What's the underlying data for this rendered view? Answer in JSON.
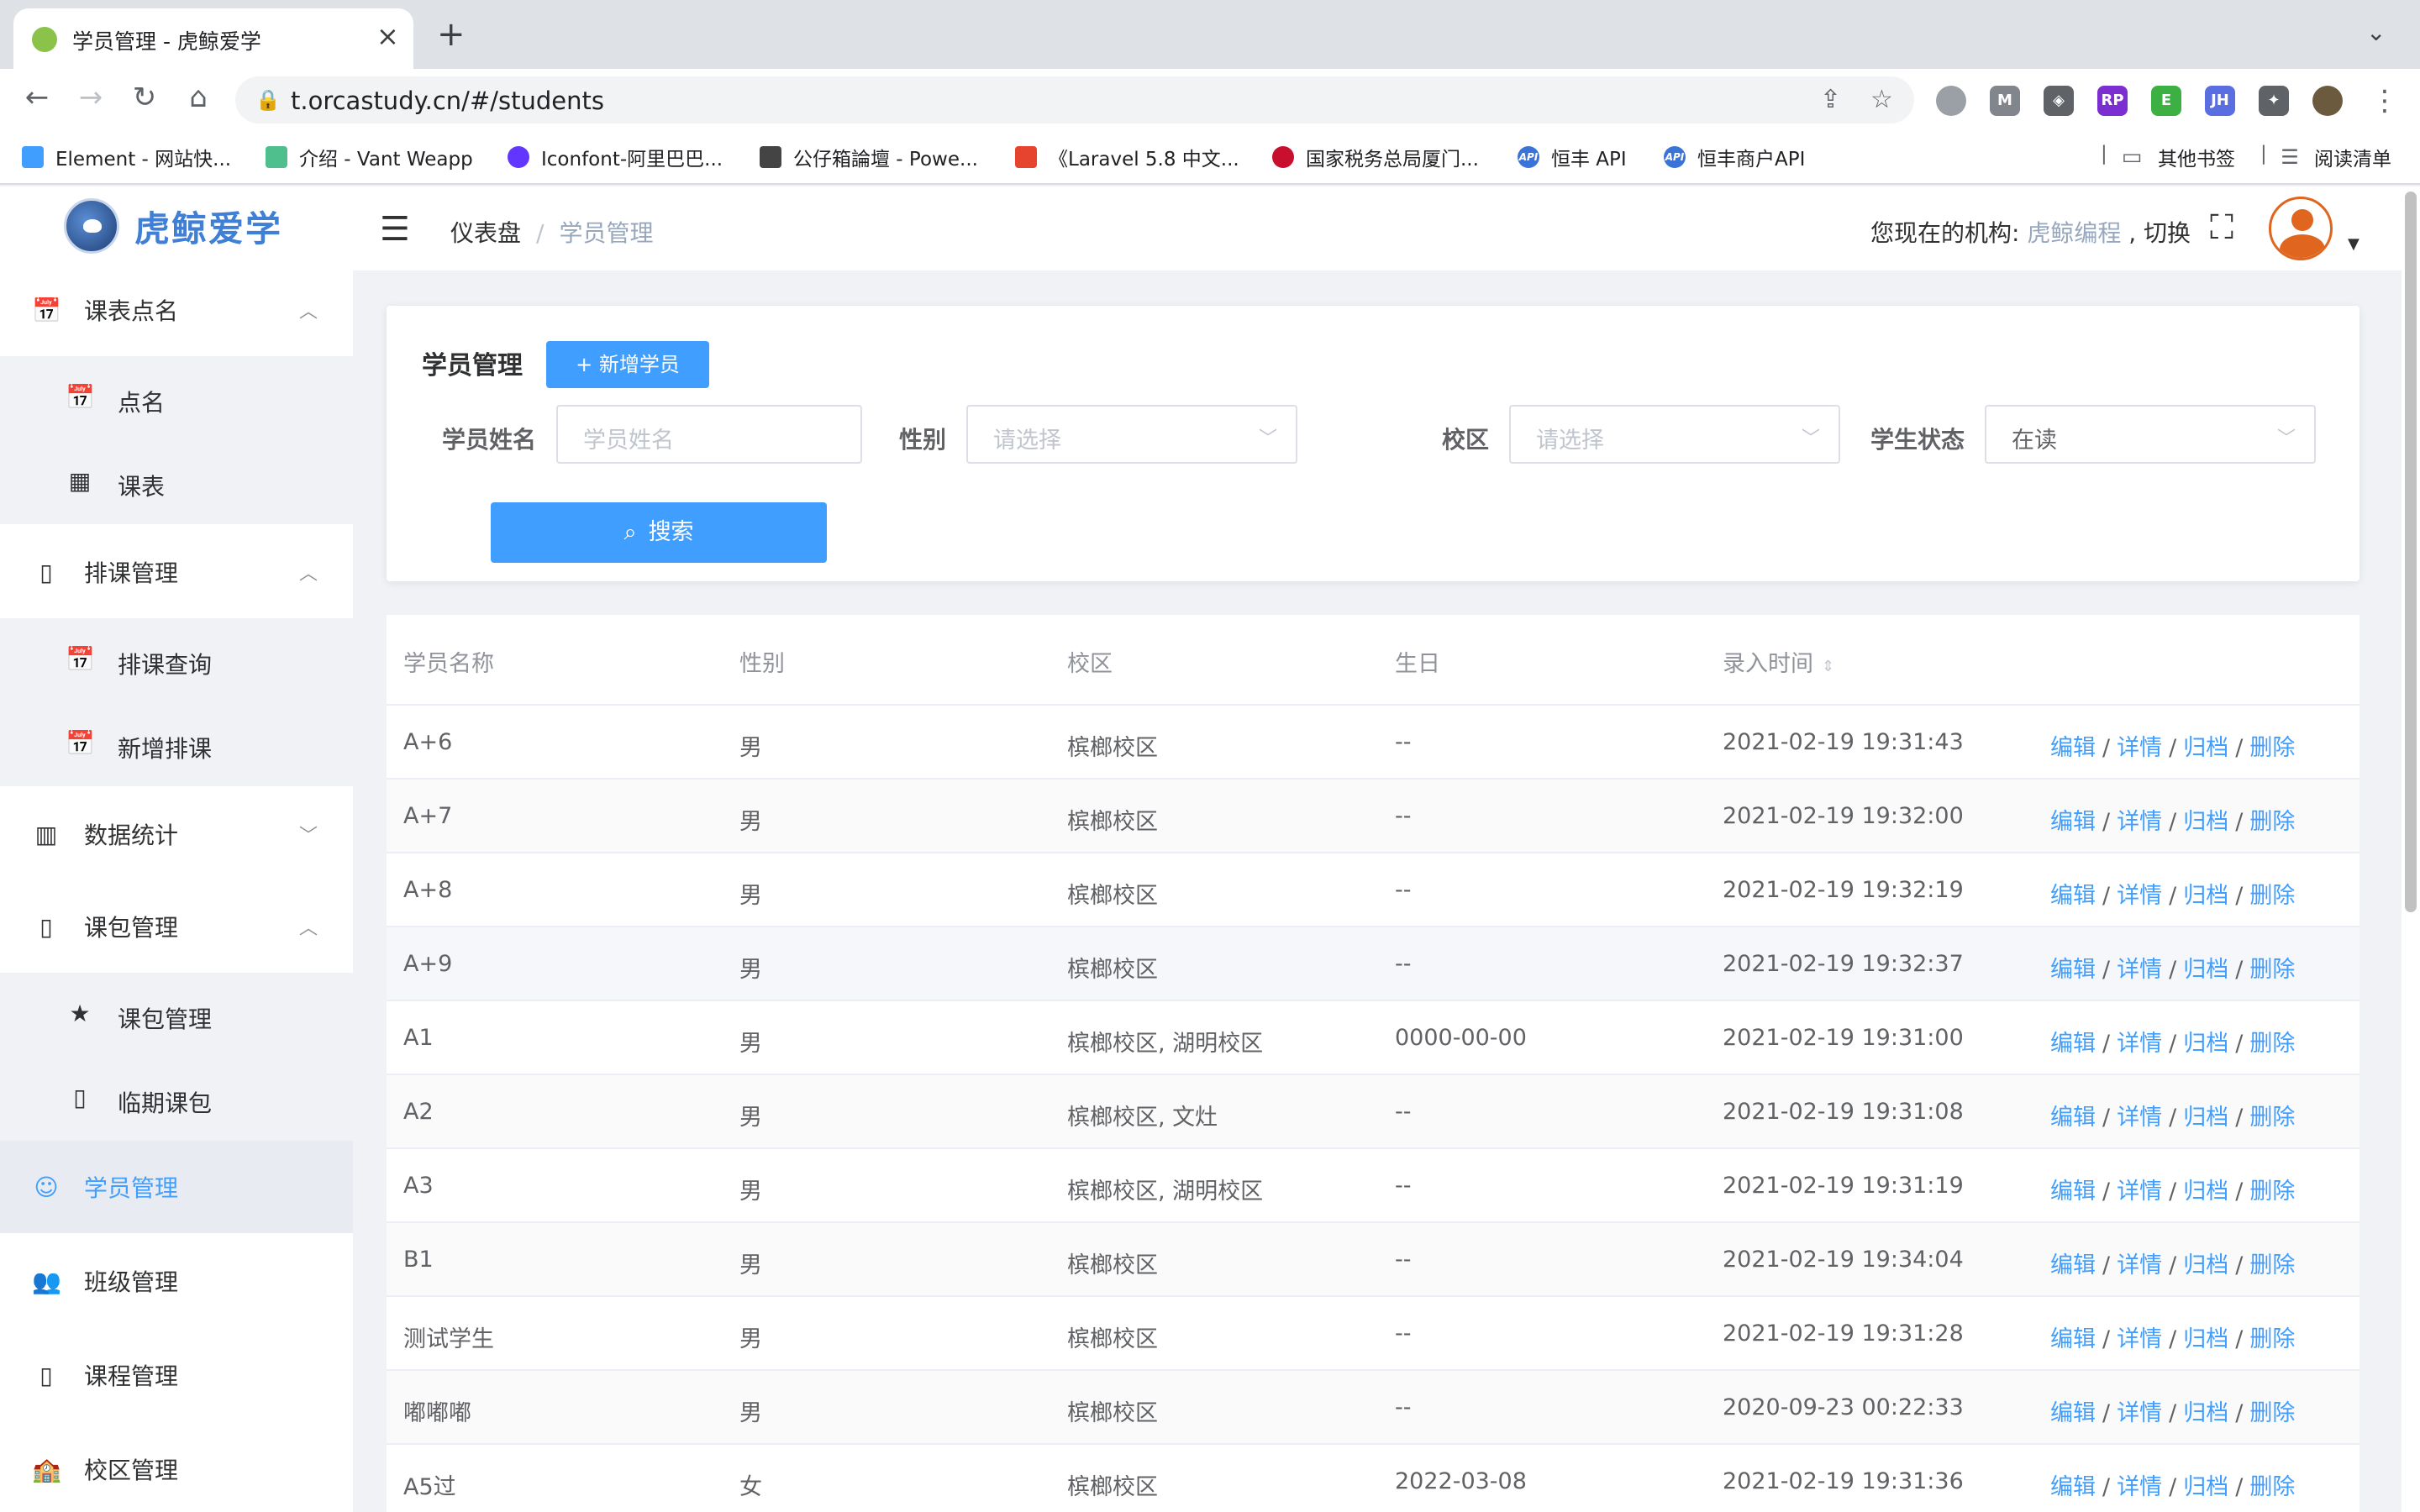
{
  "browser": {
    "tab_title": "学员管理 - 虎鲸爱学",
    "url": "t.orcastudy.cn/#/students",
    "bookmarks": [
      "Element - 网站快...",
      "介绍 - Vant Weapp",
      "Iconfont-阿里巴巴...",
      "公仔箱論壇 - Powe...",
      "《Laravel 5.8 中文...",
      "国家税务总局厦门...",
      "恒丰 API",
      "恒丰商户API"
    ],
    "other_bookmarks": "其他书签",
    "reading_list": "阅读清单"
  },
  "app": {
    "logo_text": "虎鲸爱学",
    "menu": [
      {
        "label": "课表点名",
        "icon": "calendar-icon",
        "children": [
          {
            "label": "点名",
            "icon": "calendar-icon"
          },
          {
            "label": "课表",
            "icon": "grid-icon"
          }
        ]
      },
      {
        "label": "排课管理",
        "icon": "book-icon",
        "children": [
          {
            "label": "排课查询",
            "icon": "calendar-icon"
          },
          {
            "label": "新增排课",
            "icon": "calendar-icon"
          }
        ]
      },
      {
        "label": "数据统计",
        "icon": "chart-icon"
      },
      {
        "label": "课包管理",
        "icon": "book-icon",
        "children": [
          {
            "label": "课包管理",
            "icon": "star-icon"
          },
          {
            "label": "临期课包",
            "icon": "book-icon"
          }
        ]
      },
      {
        "label": "学员管理",
        "icon": "student-icon",
        "active": true
      },
      {
        "label": "班级管理",
        "icon": "people-icon"
      },
      {
        "label": "课程管理",
        "icon": "book-icon"
      },
      {
        "label": "校区管理",
        "icon": "school-icon"
      }
    ],
    "breadcrumb": {
      "home": "仪表盘",
      "current": "学员管理"
    },
    "org_prefix": "您现在的机构: ",
    "org_name": "虎鲸编程",
    "org_switch": " , 切换"
  },
  "search_panel": {
    "title": "学员管理",
    "add_button": "+ 新增学员",
    "name_label": "学员姓名",
    "name_placeholder": "学员姓名",
    "gender_label": "性别",
    "gender_placeholder": "请选择",
    "campus_label": "校区",
    "campus_placeholder": "请选择",
    "status_label": "学生状态",
    "status_value": "在读",
    "search_button": "搜索"
  },
  "table": {
    "columns": [
      "学员名称",
      "性别",
      "校区",
      "生日",
      "录入时间"
    ],
    "actions": [
      "编辑",
      "详情",
      "归档",
      "删除"
    ],
    "rows": [
      {
        "name": "A+6",
        "gender": "男",
        "campus": "槟榔校区",
        "birthday": "--",
        "created": "2021-02-19 19:31:43"
      },
      {
        "name": "A+7",
        "gender": "男",
        "campus": "槟榔校区",
        "birthday": "--",
        "created": "2021-02-19 19:32:00"
      },
      {
        "name": "A+8",
        "gender": "男",
        "campus": "槟榔校区",
        "birthday": "--",
        "created": "2021-02-19 19:32:19"
      },
      {
        "name": "A+9",
        "gender": "男",
        "campus": "槟榔校区",
        "birthday": "--",
        "created": "2021-02-19 19:32:37"
      },
      {
        "name": "A1",
        "gender": "男",
        "campus": "槟榔校区, 湖明校区",
        "birthday": "0000-00-00",
        "created": "2021-02-19 19:31:00"
      },
      {
        "name": "A2",
        "gender": "男",
        "campus": "槟榔校区, 文灶",
        "birthday": "--",
        "created": "2021-02-19 19:31:08"
      },
      {
        "name": "A3",
        "gender": "男",
        "campus": "槟榔校区, 湖明校区",
        "birthday": "--",
        "created": "2021-02-19 19:31:19"
      },
      {
        "name": "B1",
        "gender": "男",
        "campus": "槟榔校区",
        "birthday": "--",
        "created": "2021-02-19 19:34:04"
      },
      {
        "name": "测试学生",
        "gender": "男",
        "campus": "槟榔校区",
        "birthday": "--",
        "created": "2021-02-19 19:31:28"
      },
      {
        "name": "嘟嘟嘟",
        "gender": "男",
        "campus": "槟榔校区",
        "birthday": "--",
        "created": "2020-09-23 00:22:33"
      },
      {
        "name": "A5过",
        "gender": "女",
        "campus": "槟榔校区",
        "birthday": "2022-03-08",
        "created": "2021-02-19 19:31:36"
      }
    ]
  },
  "colors": {
    "primary": "#409eff",
    "brand_text": "#3f7fd6",
    "sidebar_active_bg": "#e8ecf2"
  }
}
